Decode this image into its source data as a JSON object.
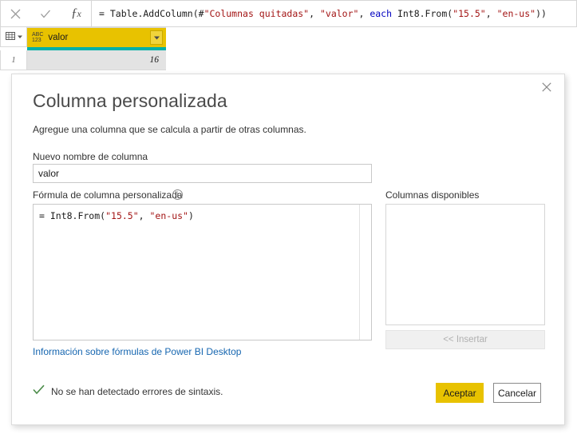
{
  "formula_bar": {
    "cancel_icon": "x-icon",
    "accept_icon": "check-icon",
    "fx_icon": "fx-icon",
    "formula_segments": [
      {
        "text": "= Table.AddColumn(#",
        "kind": "op"
      },
      {
        "text": "\"Columnas quitadas\"",
        "kind": "str"
      },
      {
        "text": ", ",
        "kind": "op"
      },
      {
        "text": "\"valor\"",
        "kind": "str"
      },
      {
        "text": ", ",
        "kind": "op"
      },
      {
        "text": "each",
        "kind": "kw"
      },
      {
        "text": " Int8.From(",
        "kind": "op"
      },
      {
        "text": "\"15.5\"",
        "kind": "str"
      },
      {
        "text": ", ",
        "kind": "op"
      },
      {
        "text": "\"en-us\"",
        "kind": "str"
      },
      {
        "text": "))",
        "kind": "op"
      }
    ],
    "formula_plain": "= Table.AddColumn(#\"Columnas quitadas\", \"valor\", each Int8.From(\"15.5\", \"en-us\"))"
  },
  "grid": {
    "select_all_icon": "table-select-icon",
    "column": {
      "type_badge_line1": "ABC",
      "type_badge_line2": "123",
      "name": "valor",
      "dropdown_icon": "chevron-down-icon",
      "header_color": "#e8c200",
      "underline_color": "#00b0a6"
    },
    "rows": [
      {
        "number": "1",
        "value": "16"
      }
    ]
  },
  "dialog": {
    "close_icon": "close-icon",
    "title": "Columna personalizada",
    "subtitle": "Agregue una columna que se calcula a partir de otras columnas.",
    "new_column_name_label": "Nuevo nombre de columna",
    "new_column_name_value": "valor",
    "custom_formula_label": "Fórmula de columna personalizada",
    "info_icon": "info-icon",
    "info_glyph": "i",
    "formula_segments": [
      {
        "text": "= Int8.From(",
        "kind": "op"
      },
      {
        "text": "\"15.5\"",
        "kind": "str"
      },
      {
        "text": ", ",
        "kind": "op"
      },
      {
        "text": "\"en-us\"",
        "kind": "str"
      },
      {
        "text": ")",
        "kind": "op"
      }
    ],
    "formula_plain": "= Int8.From(\"15.5\", \"en-us\")",
    "help_link": "Información sobre fórmulas de Power BI Desktop",
    "available_columns_label": "Columnas disponibles",
    "available_columns": [],
    "insert_button": "<< Insertar",
    "insert_button_enabled": false,
    "status_icon": "check-icon",
    "status_text": "No se han detectado errores de sintaxis.",
    "ok_button": "Aceptar",
    "cancel_button": "Cancelar",
    "accent_color": "#e8c200",
    "link_color": "#1666b0",
    "status_check_color": "#4c8c4a"
  }
}
